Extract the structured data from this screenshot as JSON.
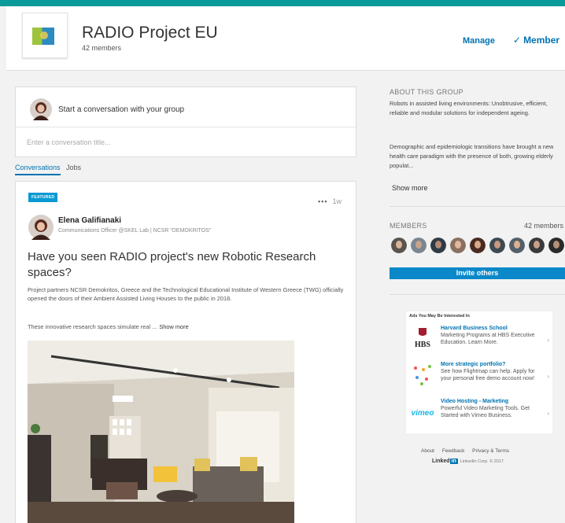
{
  "group": {
    "name": "RADIO Project EU",
    "member_count": "42 members",
    "manage_label": "Manage",
    "member_label": "Member"
  },
  "composer": {
    "prompt": "Start a conversation with your group",
    "title_placeholder": "Enter a conversation title..."
  },
  "tabs": [
    {
      "label": "Conversations",
      "active": true
    },
    {
      "label": "Jobs",
      "active": false
    }
  ],
  "post": {
    "badge": "FEATURED",
    "more_icon": "more-dots-icon",
    "age": "1w",
    "author": "Elena Galifianaki",
    "author_role": "Communications Officer @SKEL Lab | NCSR \"DEMOKRITOS\"",
    "title": "Have you seen RADIO project's new Robotic Research spaces?",
    "body": "Project partners NCSR Demokritos, Greece and the Technological Educational Institute of Western Greece (TWG) officially opened the doors of their Ambient Assisted Living Houses to the public in 2018.",
    "teaser": "These innovative research spaces simulate real ...",
    "show_more": "Show more"
  },
  "about": {
    "heading": "ABOUT THIS GROUP",
    "paragraph1": "Robots in assisted living environments: Unobtrusive, efficient, reliable and modular solutions for independent ageing.",
    "paragraph2": "Demographic and epidemiologic transitions have brought a new health care paradigm with the presence of both, growing elderly populat...",
    "show_more": "Show more"
  },
  "members": {
    "heading": "MEMBERS",
    "count": "42 members",
    "invite_label": "Invite others"
  },
  "ads": {
    "heading": "Ads You May Be Interested In",
    "items": [
      {
        "title": "Harvard Business School",
        "text": "Marketing Programs at HBS Executive Education. Learn More.",
        "logo": "HBS"
      },
      {
        "title": "More strategic portfolio?",
        "text": "See how Flightmap can help. Apply for your personal free demo account now!",
        "logo": "flightmap-icon"
      },
      {
        "title": "Video Hosting - Marketing",
        "text": "Powerful Video Marketing Tools. Get Started with Vimeo Business.",
        "logo": "vimeo"
      }
    ]
  },
  "footer": {
    "links": [
      "About",
      "Feedback",
      "Privacy & Terms"
    ],
    "brand": "Linked",
    "brand_in": "in",
    "copyright": "LinkedIn Corp. © 2017"
  },
  "colors": {
    "accent": "#0a9a9a",
    "link": "#0073b1",
    "invite": "#0a88c9",
    "badge": "#0a99d4"
  }
}
